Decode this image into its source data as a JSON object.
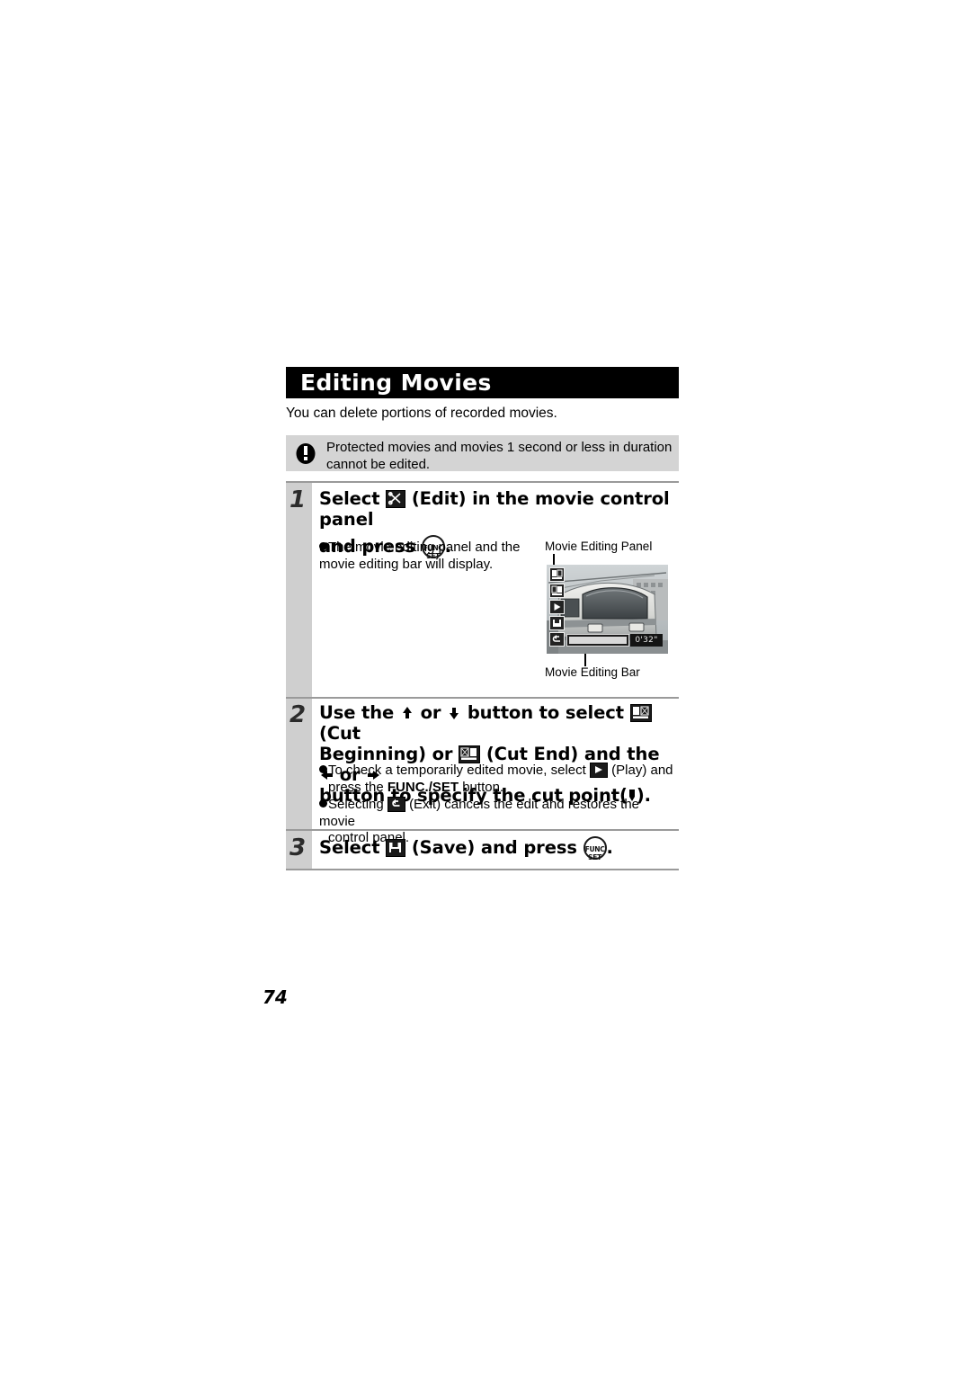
{
  "document": {
    "section_title": "Editing Movies",
    "intro": "You can delete portions of recorded movies.",
    "page_number": "74"
  },
  "caution": {
    "icon": "exclamation-icon",
    "text": "Protected movies and movies 1 second or less in duration cannot be edited."
  },
  "steps": [
    {
      "number": "1",
      "heading_part1": "Select",
      "icon1": "scissors-edit-icon",
      "heading_part2": "(Edit) in the movie control panel",
      "heading_part3": "and press",
      "icon2": "func-set-button-icon",
      "heading_part4": ".",
      "bullets": [
        {
          "text_before": "The movie editing panel and the movie editing bar will display.",
          "text_after": ""
        }
      ]
    },
    {
      "number": "2",
      "heading_part1": "Use the",
      "icon_up": "arrow-up-icon",
      "heading_or1": "or",
      "icon_down": "arrow-down-icon",
      "heading_part2": "button to select",
      "icon_cut_begin": "cut-beginning-icon",
      "heading_part3": "(Cut",
      "heading_part4": "Beginning) or",
      "icon_cut_end": "cut-end-icon",
      "heading_part5": "(Cut End) and the",
      "icon_left": "arrow-left-icon",
      "heading_or2": "or",
      "icon_right": "arrow-right-icon",
      "heading_part6": "button to specify the cut point(",
      "icon_cutpoint": "cut-point-marker-icon",
      "heading_part7": ").",
      "bullets": [
        {
          "text_before": "To check a temporarily edited movie, select",
          "icon": "play-icon",
          "text_mid": "(Play) and",
          "text_line2_before": "press the ",
          "text_line2_bold": "FUNC./SET",
          "text_line2_after": " button."
        },
        {
          "text_before": "Selecting",
          "icon": "exit-icon",
          "text_mid": "(Exit) cancels the edit and restores the movie",
          "text_line2": "control panel."
        }
      ]
    },
    {
      "number": "3",
      "heading_part1": "Select",
      "icon1": "save-icon",
      "heading_part2": "(Save) and press",
      "icon2": "func-set-button-icon",
      "heading_part3": "."
    }
  ],
  "illustration": {
    "caption_top": "Movie Editing Panel",
    "caption_bottom": "Movie Editing Bar",
    "lcd": {
      "time_display": "0'32\"",
      "panel_icons": [
        "cut-beginning-icon",
        "cut-end-icon",
        "play-icon",
        "save-icon",
        "exit-icon"
      ]
    }
  },
  "func_set": {
    "line1": "FUNC",
    "line2": "SET"
  }
}
